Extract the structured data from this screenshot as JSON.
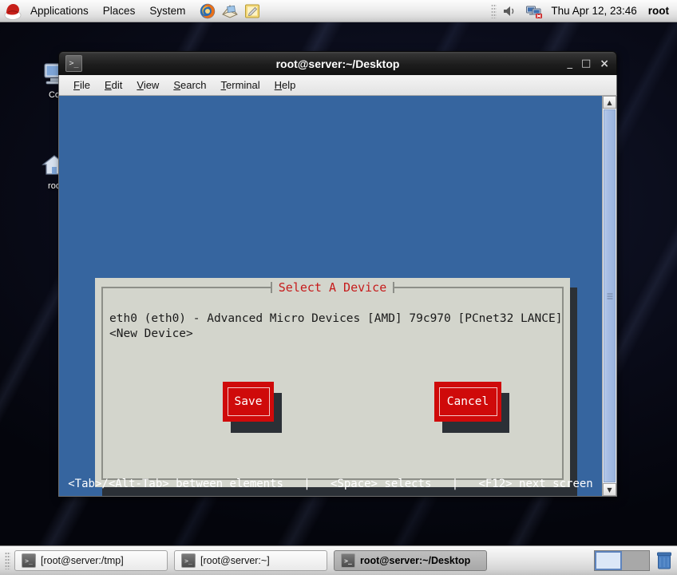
{
  "top_panel": {
    "logo_name": "red-hat-logo",
    "menus": [
      "Applications",
      "Places",
      "System"
    ],
    "launchers": [
      {
        "name": "firefox-launcher-icon",
        "title": "Firefox Web Browser"
      },
      {
        "name": "email-launcher-icon",
        "title": "Evolution Mail"
      },
      {
        "name": "text-editor-launcher-icon",
        "title": "Text Editor"
      }
    ],
    "tray": [
      {
        "name": "volume-icon"
      },
      {
        "name": "network-disconnected-icon"
      }
    ],
    "clock": "Thu Apr 12, 23:46",
    "user": "root"
  },
  "desktop_icons": [
    {
      "name": "computer-icon",
      "label": "Co"
    },
    {
      "name": "root-home-icon",
      "label": "roo"
    }
  ],
  "terminal": {
    "title": "root@server:~/Desktop",
    "icon_name": "terminal-icon",
    "window_buttons": {
      "minimize": "_",
      "maximize": "□",
      "close": "×"
    },
    "menus": [
      {
        "label": "File",
        "mnemonic": "F"
      },
      {
        "label": "Edit",
        "mnemonic": "E"
      },
      {
        "label": "View",
        "mnemonic": "V"
      },
      {
        "label": "Search",
        "mnemonic": "S"
      },
      {
        "label": "Terminal",
        "mnemonic": "T"
      },
      {
        "label": "Help",
        "mnemonic": "H"
      }
    ],
    "scrollbar": {
      "up_arrow": "▲",
      "down_arrow": "▼"
    }
  },
  "dialog": {
    "title": "Select A Device",
    "title_color": "#c61b1b",
    "items": [
      {
        "text": "eth0 (eth0) - Advanced Micro Devices [AMD] 79c970 [PCnet32 LANCE]",
        "selected": true
      },
      {
        "text": "<New Device>",
        "selected": false
      }
    ],
    "buttons": [
      {
        "name": "save-button",
        "label": "Save"
      },
      {
        "name": "cancel-button",
        "label": "Cancel"
      }
    ],
    "accent_color": "#cf0a0a",
    "background_color": "#d3d5cc"
  },
  "status_line": {
    "hint1": "<Tab>/<Alt-Tab> between elements",
    "sep1": "|",
    "hint2": "<Space> selects",
    "sep2": "|",
    "hint3": "<F12> next screen"
  },
  "bottom_panel": {
    "tasks": [
      {
        "label": "[root@server:/tmp]",
        "active": false
      },
      {
        "label": "[root@server:~]",
        "active": false
      },
      {
        "label": "root@server:~/Desktop",
        "active": true
      }
    ],
    "workspaces": [
      {
        "name": "workspace-1",
        "active": true
      },
      {
        "name": "workspace-2",
        "active": false
      }
    ],
    "trash_name": "trash-icon"
  }
}
